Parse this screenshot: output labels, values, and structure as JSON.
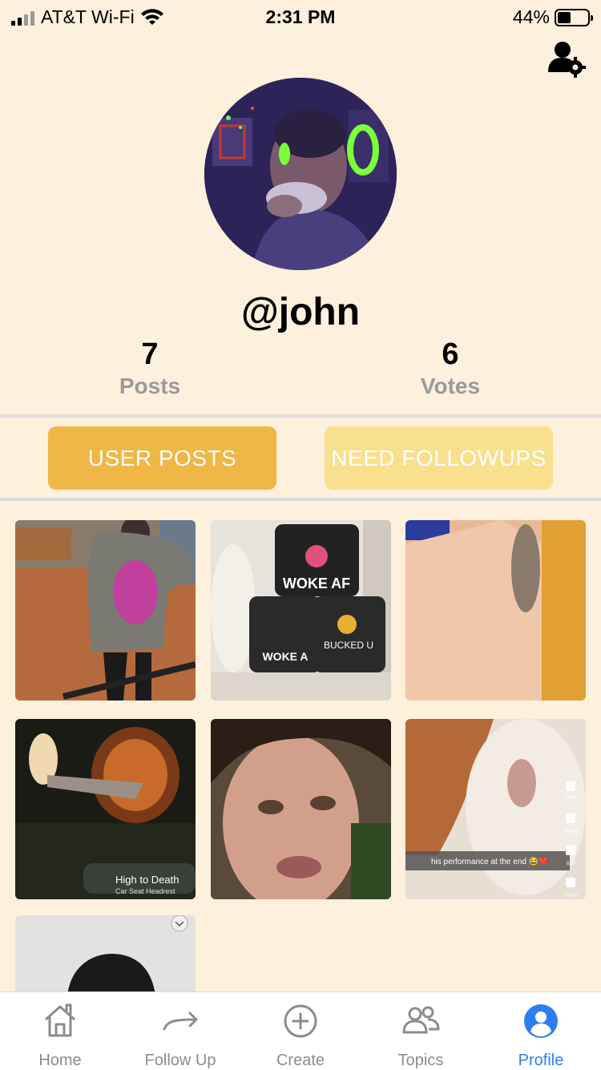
{
  "status_bar": {
    "carrier": "AT&T Wi-Fi",
    "time": "2:31 PM",
    "battery": "44%",
    "battery_level": 0.44
  },
  "profile": {
    "username": "@john"
  },
  "stats": [
    {
      "value": "7",
      "label": "Posts"
    },
    {
      "value": "6",
      "label": "Votes"
    }
  ],
  "toggle": {
    "user_posts": "USER POSTS",
    "need_followups": "NEED FOLLOWUPS"
  },
  "posts": [
    {
      "name": "post-girl-metallica-hoodie",
      "overlay": ""
    },
    {
      "name": "post-woke-af-tubs",
      "overlay": ""
    },
    {
      "name": "post-cat-on-tile",
      "overlay": ""
    },
    {
      "name": "post-pumpkin",
      "overlay": "High to Death"
    },
    {
      "name": "post-face-closeup",
      "overlay": ""
    },
    {
      "name": "post-dog",
      "overlay": "his performance at the end 😂❤️"
    },
    {
      "name": "post-person-partial",
      "overlay": ""
    }
  ],
  "dog_sidebar": {
    "likes": "863K",
    "dislike": "Dislike",
    "comments": "8.1K",
    "share": "Share"
  },
  "pumpkin_subtitle": "Car Seat Headrest",
  "nav": [
    {
      "label": "Home",
      "icon": "home-icon",
      "active": false
    },
    {
      "label": "Follow Up",
      "icon": "arrow-right-icon",
      "active": false
    },
    {
      "label": "Create",
      "icon": "plus-circle-icon",
      "active": false
    },
    {
      "label": "Topics",
      "icon": "people-icon",
      "active": false
    },
    {
      "label": "Profile",
      "icon": "user-circle-icon",
      "active": true
    }
  ],
  "colors": {
    "background": "#fdf0dc",
    "accent": "#f0b646",
    "accent_light": "#f8e08e",
    "active_tab": "#2d7ff0"
  }
}
